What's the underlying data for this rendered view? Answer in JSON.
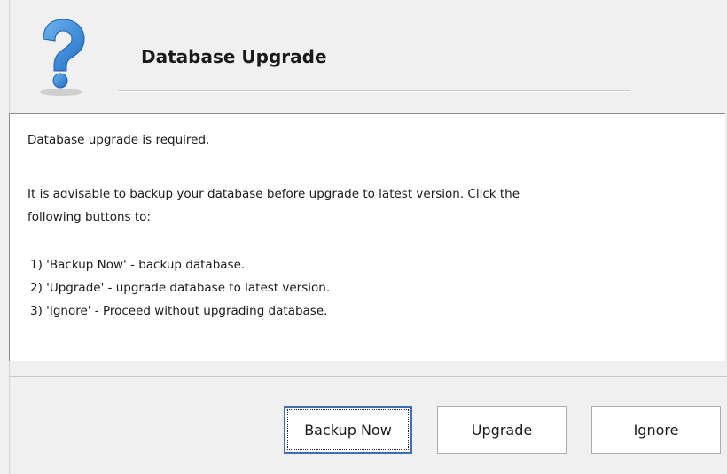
{
  "dialog": {
    "title": "Database Upgrade",
    "icon": "question-mark-icon"
  },
  "message": {
    "line1": "Database upgrade is required.",
    "line2": "It is advisable to backup your database before upgrade to latest version. Click the",
    "line3": "following buttons to:",
    "options": [
      "1) 'Backup Now' - backup database.",
      "2) 'Upgrade' - upgrade database to latest version.",
      "3) 'Ignore' - Proceed without upgrading database."
    ]
  },
  "buttons": {
    "backup_now": "Backup Now",
    "upgrade": "Upgrade",
    "ignore": "Ignore"
  },
  "colors": {
    "icon_blue": "#2f7fd0",
    "default_button_border": "#3c6fb5",
    "background": "#f0f0f0"
  }
}
